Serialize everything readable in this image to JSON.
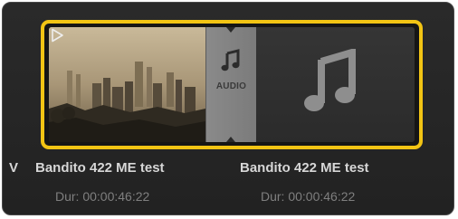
{
  "media_pool": {
    "previous_clip_partial_label": "V",
    "clips": [
      {
        "name": "Bandito 422 ME test",
        "duration": "Dur: 00:00:46:22",
        "type": "video"
      },
      {
        "name": "Bandito 422 ME test",
        "duration": "Dur: 00:00:46:22",
        "type": "audio"
      }
    ],
    "linked_audio_label": "AUDIO",
    "selection_color": "#f2c414",
    "icons": {
      "play": "play-triangle-icon",
      "audio": "music-note-icon"
    }
  }
}
